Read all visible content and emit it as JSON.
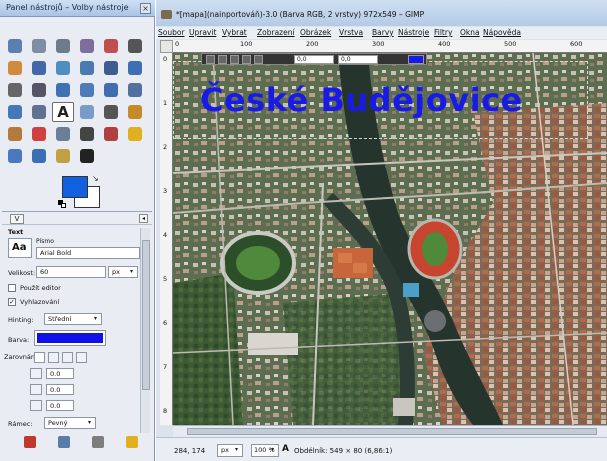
{
  "toolbox": {
    "title": "Panel nástrojů – Volby nástroje",
    "close": "×",
    "tools": [
      "rect-select-icon",
      "ellipse-select-icon",
      "free-select-icon",
      "fuzzy-select-icon",
      "by-color-select-icon",
      "scissors-select-icon",
      "foreground-select-icon",
      "paths-icon",
      "color-picker-icon",
      "zoom-icon",
      "measure-icon",
      "move-icon",
      "align-icon",
      "crop-icon",
      "rotate-icon",
      "scale-icon",
      "shear-icon",
      "perspective-icon",
      "flip-icon",
      "cage-icon",
      "text-tool-icon",
      "heal-icon",
      "blend-icon",
      "pencil-icon",
      "paintbrush-icon",
      "eraser-icon",
      "airbrush-icon",
      "ink-icon",
      "clone-icon",
      "dodge-burn-icon",
      "bucket-fill-icon",
      "blur-icon",
      "smudge-icon",
      "dodge-icon"
    ],
    "text_tool_glyph": "A",
    "color_swap": "↘",
    "fg_color": "#1060e0",
    "bg_color": "#ffffff",
    "options": {
      "section_title": "Text",
      "font_label": "Písmo",
      "font_preview": "Aa",
      "font_value": "Arial Bold",
      "size_label": "Velikost:",
      "size_value": "60",
      "size_unit": "px",
      "use_editor_label": "Použít editor",
      "antialias_label": "Vyhlazování",
      "antialias_checked": "✓",
      "hinting_label": "Hinting:",
      "hinting_value": "Střední",
      "color_label": "Barva:",
      "text_color": "#1010e8",
      "justify_label": "Zarovnání:",
      "indent_value": "0.0",
      "line_spacing_value": "0.0",
      "letter_spacing_value": "0.0",
      "box_label": "Rámec:",
      "box_value": "Pevný"
    }
  },
  "image_window": {
    "title": "*[mapa](nainportováň)-3.0 (Barva RGB, 2 vrstvy) 972x549 – GIMP",
    "menu": [
      "Soubor",
      "Upravit",
      "Vybrat",
      "Zobrazení",
      "Obrázek",
      "Vrstva",
      "Barvy",
      "Nástroje",
      "Filtry",
      "Okna",
      "Nápověda"
    ],
    "ruler_h_labels": [
      "0",
      "100",
      "200",
      "300",
      "400",
      "500",
      "600"
    ],
    "ruler_v_labels": [
      "0",
      "1",
      "2",
      "3",
      "4",
      "5",
      "6",
      "7",
      "8"
    ],
    "canvas_text": "České Budějovice",
    "text_toolbar_value": "0,0",
    "status": {
      "coords": "284, 174",
      "unit": "px",
      "zoom": "100 %",
      "message": "Obdélník: 549 × 80  (6,86:1)"
    }
  }
}
